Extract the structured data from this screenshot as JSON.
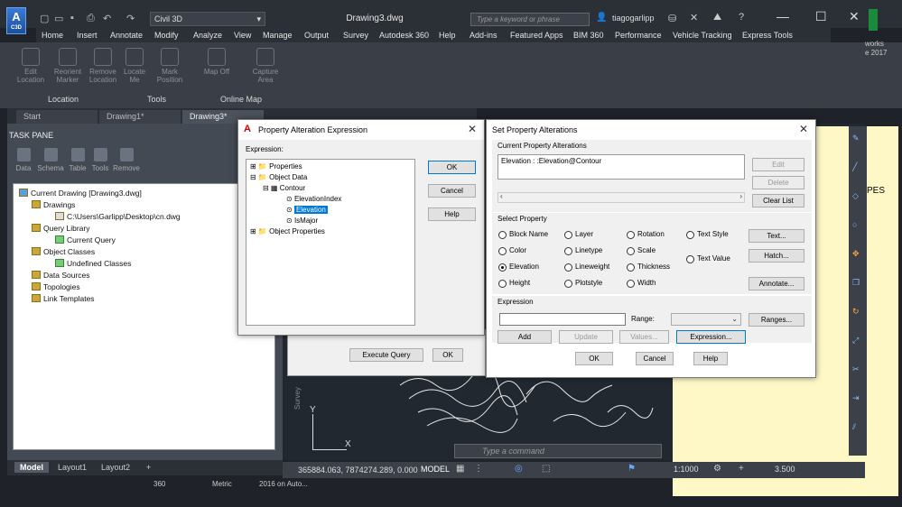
{
  "app": {
    "logo_letter": "A",
    "logo_sub": "C3D",
    "workspace": "Civil 3D",
    "title": "Drawing3.dwg",
    "search_placeholder": "Type a keyword or phrase",
    "user": "tiagogarlipp"
  },
  "menu": [
    "Home",
    "Insert",
    "Annotate",
    "Modify",
    "Analyze",
    "View",
    "Manage",
    "Output",
    "Survey",
    "Autodesk 360",
    "Help",
    "Add-ins",
    "Featured Apps",
    "BIM 360",
    "Performance",
    "Vehicle Tracking",
    "Express Tools"
  ],
  "ribbon": {
    "buttons": [
      "Edit Location",
      "Reorient Marker",
      "Remove Location",
      "Locate Me",
      "Mark Position",
      "Map Off",
      "Capture Area"
    ],
    "panels": [
      "Location",
      "Tools",
      "Online Map"
    ]
  },
  "file_tabs": [
    "Start",
    "Drawing1*",
    "Drawing3*"
  ],
  "task_pane": {
    "title": "TASK PANE",
    "tools": [
      "Data",
      "Schema",
      "Table",
      "Tools",
      "Remove"
    ],
    "tree": {
      "current": "Current Drawing [Drawing3.dwg]",
      "drawings": "Drawings",
      "drawing_path": "C:\\Users\\Garlipp\\Desktop\\cn.dwg",
      "query_library": "Query Library",
      "current_query": "Current Query",
      "object_classes": "Object Classes",
      "undefined_classes": "Undefined Classes",
      "data_sources": "Data Sources",
      "topologies": "Topologies",
      "link_templates": "Link Templates"
    }
  },
  "layout_tabs": [
    "Model",
    "Layout1",
    "Layout2"
  ],
  "statusbar": {
    "coords": "365884.063, 7874274.289, 0.000",
    "model": "MODEL",
    "scale": "1:1000",
    "lineweight": "3.500"
  },
  "command_placeholder": "Type a command",
  "bottom_texts": [
    "360",
    "Metric",
    "2016 on Auto..."
  ],
  "ucs": {
    "y": "Y",
    "x": "X"
  },
  "survey_label": "Survey",
  "right_side_texts": [
    "works",
    "e 2017",
    "PES"
  ],
  "query_dialog_buttons": {
    "execute": "Execute Query",
    "ok": "OK"
  },
  "expr_dialog": {
    "title": "Property Alteration Expression",
    "label": "Expression:",
    "tree": [
      "Properties",
      "Object Data",
      "Contour",
      "ElevationIndex",
      "Elevation",
      "IsMajor",
      "Object Properties"
    ],
    "ok": "OK",
    "cancel": "Cancel",
    "help": "Help"
  },
  "alter_dialog": {
    "title": "Set Property Alterations",
    "current_label": "Current Property Alterations",
    "current_value": "Elevation : :Elevation@Contour",
    "edit": "Edit",
    "delete": "Delete",
    "clear": "Clear List",
    "select_label": "Select Property",
    "properties": [
      "Block Name",
      "Layer",
      "Rotation",
      "Text Style",
      "Color",
      "Linetype",
      "Scale",
      "Text Value",
      "Elevation",
      "Lineweight",
      "Thickness",
      "Height",
      "Plotstyle",
      "Width"
    ],
    "selected": "Elevation",
    "text_btn": "Text...",
    "hatch_btn": "Hatch...",
    "annotate_btn": "Annotate...",
    "expression_label": "Expression",
    "range_label": "Range:",
    "ranges_btn": "Ranges...",
    "add": "Add",
    "update": "Update",
    "values": "Values...",
    "expression_btn": "Expression...",
    "ok": "OK",
    "cancel": "Cancel",
    "help": "Help"
  }
}
